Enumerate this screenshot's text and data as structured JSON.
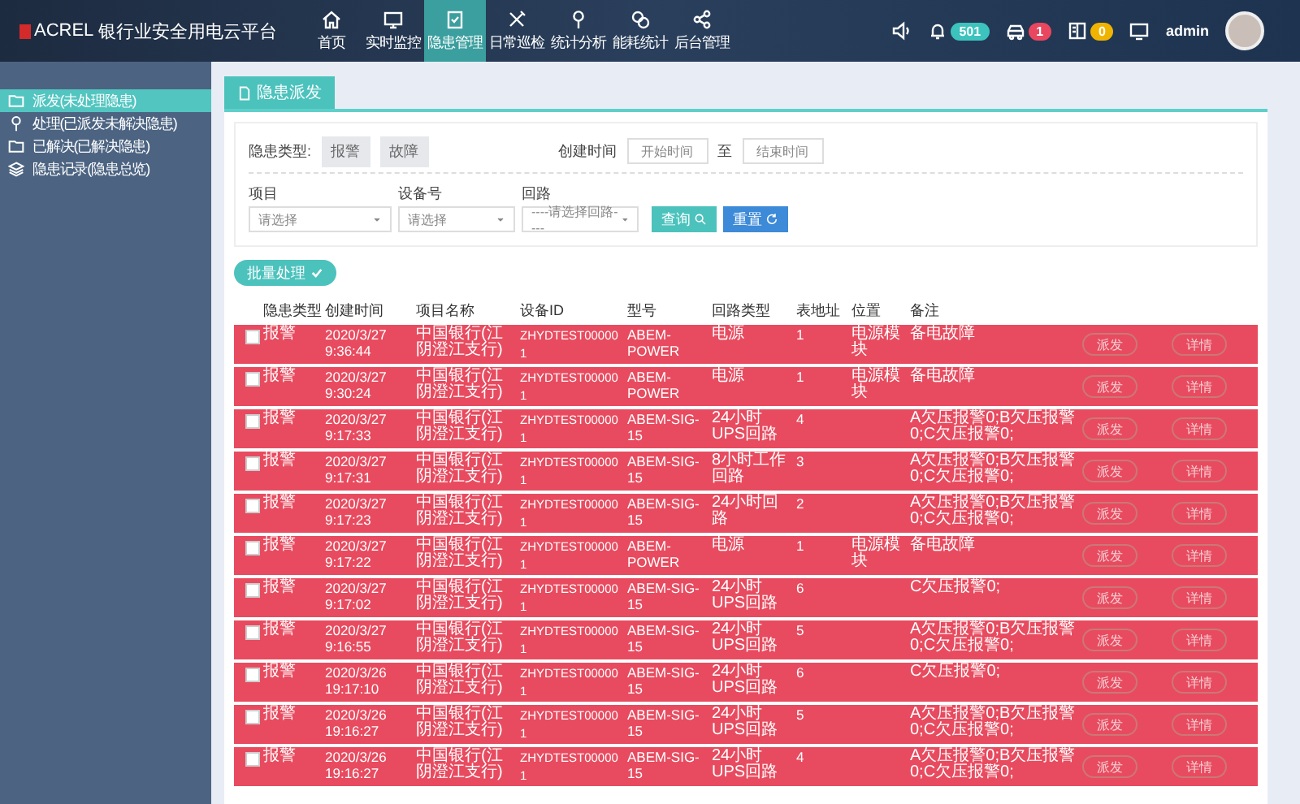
{
  "header": {
    "logo_mark": "ACREL",
    "title": "银行业安全用电云平台",
    "nav": [
      {
        "label": "首页",
        "selected": false
      },
      {
        "label": "实时监控",
        "selected": false
      },
      {
        "label": "隐患管理",
        "selected": true
      },
      {
        "label": "日常巡检",
        "selected": false
      },
      {
        "label": "统计分析",
        "selected": false
      },
      {
        "label": "能耗统计",
        "selected": false
      },
      {
        "label": "后台管理",
        "selected": false
      }
    ],
    "badges": [
      {
        "count": "501",
        "color": "#3cc3bd"
      },
      {
        "count": "1",
        "color": "#e8475f"
      },
      {
        "count": "0",
        "color": "#f0b400"
      }
    ],
    "user": "admin"
  },
  "sidebar": {
    "items": [
      {
        "label": "派发(未处理隐患)",
        "selected": true
      },
      {
        "label": "处理(已派发未解决隐患)",
        "selected": false
      },
      {
        "label": "已解决(已解决隐患)",
        "selected": false
      },
      {
        "label": "隐患记录(隐患总览)",
        "selected": false
      }
    ]
  },
  "tab": {
    "label": "隐患派发"
  },
  "filters": {
    "type_label": "隐患类型:",
    "type_options": [
      "报警",
      "故障"
    ],
    "time_label": "创建时间",
    "start_placeholder": "开始时间",
    "to": "至",
    "end_placeholder": "结束时间",
    "selects": [
      {
        "label": "项目",
        "placeholder": "请选择"
      },
      {
        "label": "设备号",
        "placeholder": "请选择"
      },
      {
        "label": "回路",
        "placeholder": "----请选择回路----"
      }
    ],
    "query": "查询",
    "reset": "重置"
  },
  "batch_button": "批量处理",
  "table": {
    "columns": [
      "隐患类型",
      "创建时间",
      "项目名称",
      "设备ID",
      "型号",
      "回路类型",
      "表地址",
      "位置",
      "备注"
    ],
    "rows": [
      {
        "checked": false,
        "cells": [
          "报警",
          "2020/3/27 9:36:44",
          "中国银行(江阴澄江支行)",
          "ZHYDTEST000001",
          "ABEM-POWER",
          "电源",
          "1",
          "电源模块",
          "备电故障"
        ],
        "actions": [
          "派发",
          "详情"
        ]
      },
      {
        "checked": false,
        "cells": [
          "报警",
          "2020/3/27 9:30:24",
          "中国银行(江阴澄江支行)",
          "ZHYDTEST000001",
          "ABEM-POWER",
          "电源",
          "1",
          "电源模块",
          "备电故障"
        ],
        "actions": [
          "派发",
          "详情"
        ]
      },
      {
        "checked": false,
        "cells": [
          "报警",
          "2020/3/27 9:17:33",
          "中国银行(江阴澄江支行)",
          "ZHYDTEST000001",
          "ABEM-SIG-15",
          "24小时UPS回路",
          "4",
          "",
          "A欠压报警0;B欠压报警0;C欠压报警0;"
        ],
        "actions": [
          "派发",
          "详情"
        ]
      },
      {
        "checked": false,
        "cells": [
          "报警",
          "2020/3/27 9:17:31",
          "中国银行(江阴澄江支行)",
          "ZHYDTEST000001",
          "ABEM-SIG-15",
          "8小时工作回路",
          "3",
          "",
          "A欠压报警0;B欠压报警0;C欠压报警0;"
        ],
        "actions": [
          "派发",
          "详情"
        ]
      },
      {
        "checked": false,
        "cells": [
          "报警",
          "2020/3/27 9:17:23",
          "中国银行(江阴澄江支行)",
          "ZHYDTEST000001",
          "ABEM-SIG-15",
          "24小时回路",
          "2",
          "",
          "A欠压报警0;B欠压报警0;C欠压报警0;"
        ],
        "actions": [
          "派发",
          "详情"
        ]
      },
      {
        "checked": false,
        "cells": [
          "报警",
          "2020/3/27 9:17:22",
          "中国银行(江阴澄江支行)",
          "ZHYDTEST000001",
          "ABEM-POWER",
          "电源",
          "1",
          "电源模块",
          "备电故障"
        ],
        "actions": [
          "派发",
          "详情"
        ]
      },
      {
        "checked": false,
        "cells": [
          "报警",
          "2020/3/27 9:17:02",
          "中国银行(江阴澄江支行)",
          "ZHYDTEST000001",
          "ABEM-SIG-15",
          "24小时UPS回路",
          "6",
          "",
          "C欠压报警0;"
        ],
        "actions": [
          "派发",
          "详情"
        ]
      },
      {
        "checked": false,
        "cells": [
          "报警",
          "2020/3/27 9:16:55",
          "中国银行(江阴澄江支行)",
          "ZHYDTEST000001",
          "ABEM-SIG-15",
          "24小时UPS回路",
          "5",
          "",
          "A欠压报警0;B欠压报警0;C欠压报警0;"
        ],
        "actions": [
          "派发",
          "详情"
        ]
      },
      {
        "checked": false,
        "cells": [
          "报警",
          "2020/3/26 19:17:10",
          "中国银行(江阴澄江支行)",
          "ZHYDTEST000001",
          "ABEM-SIG-15",
          "24小时UPS回路",
          "6",
          "",
          "C欠压报警0;"
        ],
        "actions": [
          "派发",
          "详情"
        ]
      },
      {
        "checked": false,
        "cells": [
          "报警",
          "2020/3/26 19:16:27",
          "中国银行(江阴澄江支行)",
          "ZHYDTEST000001",
          "ABEM-SIG-15",
          "24小时UPS回路",
          "5",
          "",
          "A欠压报警0;B欠压报警0;C欠压报警0;"
        ],
        "actions": [
          "派发",
          "详情"
        ]
      },
      {
        "checked": false,
        "cells": [
          "报警",
          "2020/3/26 19:16:27",
          "中国银行(江阴澄江支行)",
          "ZHYDTEST000001",
          "ABEM-SIG-15",
          "24小时UPS回路",
          "4",
          "",
          "A欠压报警0;B欠压报警0;C欠压报警0;"
        ],
        "actions": [
          "派发",
          "详情"
        ]
      }
    ]
  }
}
